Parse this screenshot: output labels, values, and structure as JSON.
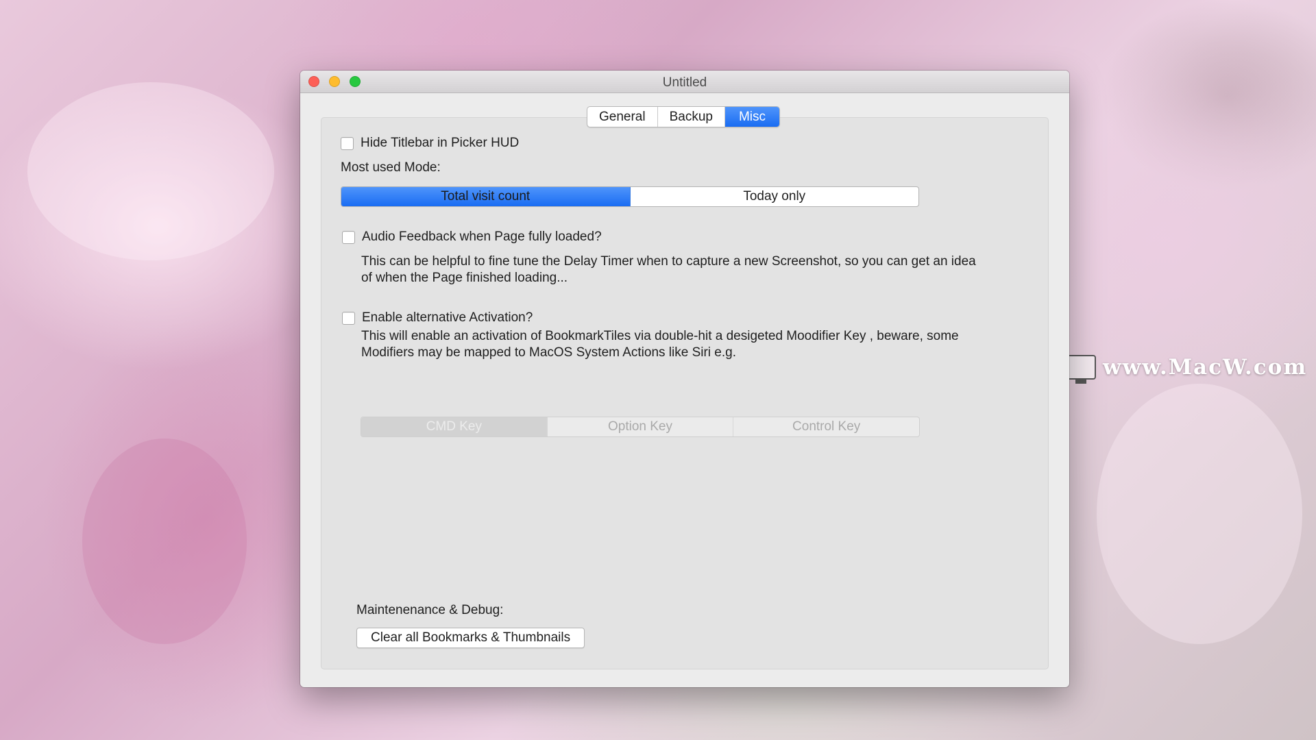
{
  "window": {
    "title": "Untitled"
  },
  "tabs": [
    {
      "label": "General",
      "active": false
    },
    {
      "label": "Backup",
      "active": false
    },
    {
      "label": "Misc",
      "active": true
    }
  ],
  "misc": {
    "hide_titlebar": {
      "label": "Hide Titlebar in Picker HUD",
      "checked": false
    },
    "most_used_mode": {
      "label": "Most used Mode:",
      "options": [
        "Total visit count",
        "Today only"
      ],
      "selected": "Total visit count"
    },
    "audio_feedback": {
      "label": "Audio Feedback when Page fully loaded?",
      "checked": false,
      "description_line1": "This can be helpful to fine tune the Delay Timer when to capture a new Screenshot, so you can get an idea",
      "description_line2": "of when the Page finished loading..."
    },
    "alt_activation": {
      "label": "Enable alternative Activation?",
      "checked": false,
      "description_line1": "This will enable an activation of BookmarkTiles via double-hit a desigeted Moodifier Key , beware, some",
      "description_line2": "Modifiers may be mapped to MacOS System Actions like Siri e.g.",
      "keys": [
        "CMD Key",
        "Option Key",
        "Control Key"
      ],
      "selected": "CMD Key"
    },
    "maintenance": {
      "label": "Maintenenance & Debug:",
      "clear_button": "Clear all Bookmarks & Thumbnails"
    }
  },
  "watermark": {
    "text": "www.MacW.com"
  },
  "colors": {
    "accent": "#1a6cf2",
    "close": "#fd5f57",
    "minimize": "#febc2e",
    "maximize": "#28c840"
  }
}
